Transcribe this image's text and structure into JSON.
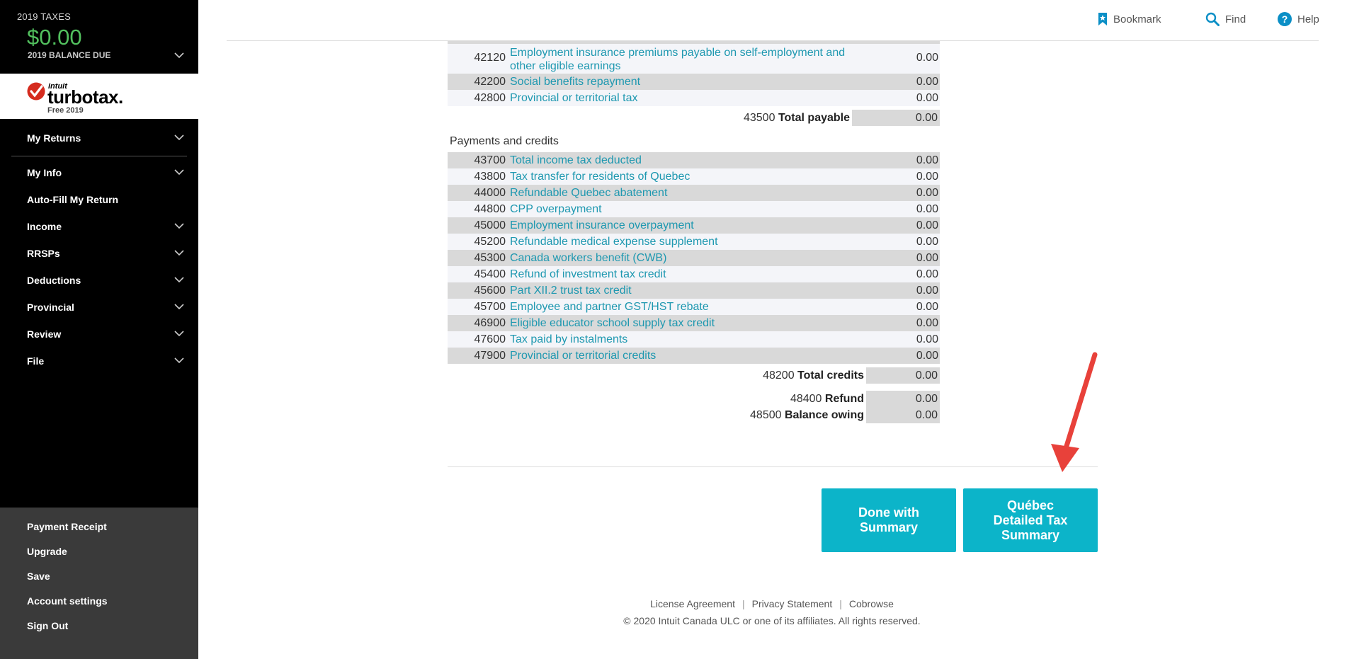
{
  "sidebar": {
    "balance": {
      "year_label": "2019 TAXES",
      "amount": "$0.00",
      "due_label": "2019 BALANCE DUE"
    },
    "logo": {
      "intuit": "intuit",
      "brand": "turbotax.",
      "edition": "Free 2019"
    },
    "my_returns": "My Returns",
    "items": [
      {
        "label": "My Info",
        "chevron": true
      },
      {
        "label": "Auto-Fill My Return",
        "chevron": false
      },
      {
        "label": "Income",
        "chevron": true
      },
      {
        "label": "RRSPs",
        "chevron": true
      },
      {
        "label": "Deductions",
        "chevron": true
      },
      {
        "label": "Provincial",
        "chevron": true
      },
      {
        "label": "Review",
        "chevron": true
      },
      {
        "label": "File",
        "chevron": true
      }
    ],
    "bottom": [
      "Payment Receipt",
      "Upgrade",
      "Save",
      "Account settings",
      "Sign Out"
    ]
  },
  "topbar": {
    "bookmark": "Bookmark",
    "find": "Find",
    "help": "Help"
  },
  "payable_rows": [
    {
      "code": "42120",
      "desc": "Employment insurance premiums payable on self-employment and other eligible earnings",
      "value": "0.00"
    },
    {
      "code": "42200",
      "desc": "Social benefits repayment",
      "value": "0.00"
    },
    {
      "code": "42800",
      "desc": "Provincial or territorial tax",
      "value": "0.00"
    }
  ],
  "total_payable": {
    "code": "43500",
    "label": "Total payable",
    "value": "0.00"
  },
  "payments_title": "Payments and credits",
  "credit_rows": [
    {
      "code": "43700",
      "desc": "Total income tax deducted",
      "value": "0.00"
    },
    {
      "code": "43800",
      "desc": "Tax transfer for residents of Quebec",
      "value": "0.00"
    },
    {
      "code": "44000",
      "desc": "Refundable Quebec abatement",
      "value": "0.00"
    },
    {
      "code": "44800",
      "desc": "CPP overpayment",
      "value": "0.00"
    },
    {
      "code": "45000",
      "desc": "Employment insurance overpayment",
      "value": "0.00"
    },
    {
      "code": "45200",
      "desc": "Refundable medical expense supplement",
      "value": "0.00"
    },
    {
      "code": "45300",
      "desc": "Canada workers benefit (CWB)",
      "value": "0.00"
    },
    {
      "code": "45400",
      "desc": "Refund of investment tax credit",
      "value": "0.00"
    },
    {
      "code": "45600",
      "desc": "Part XII.2 trust tax credit",
      "value": "0.00"
    },
    {
      "code": "45700",
      "desc": "Employee and partner GST/HST rebate",
      "value": "0.00"
    },
    {
      "code": "46900",
      "desc": "Eligible educator school supply tax credit",
      "value": "0.00"
    },
    {
      "code": "47600",
      "desc": "Tax paid by instalments",
      "value": "0.00"
    },
    {
      "code": "47900",
      "desc": "Provincial or territorial credits",
      "value": "0.00"
    }
  ],
  "total_credits": {
    "code": "48200",
    "label": "Total credits",
    "value": "0.00"
  },
  "refund": {
    "code": "48400",
    "label": "Refund",
    "value": "0.00"
  },
  "balance_owing": {
    "code": "48500",
    "label": "Balance owing",
    "value": "0.00"
  },
  "buttons": {
    "done": "Done with Summary",
    "quebec": "Québec Detailed Tax Summary"
  },
  "footer": {
    "license": "License Agreement",
    "privacy": "Privacy Statement",
    "cobrowse": "Cobrowse",
    "copyright": "© 2020 Intuit Canada ULC or one of its affiliates. All rights reserved."
  },
  "colors": {
    "accent": "#0cb4c9",
    "link": "#1e98b0",
    "balance_green": "#52c05e",
    "annotation_arrow": "#e8413a"
  }
}
